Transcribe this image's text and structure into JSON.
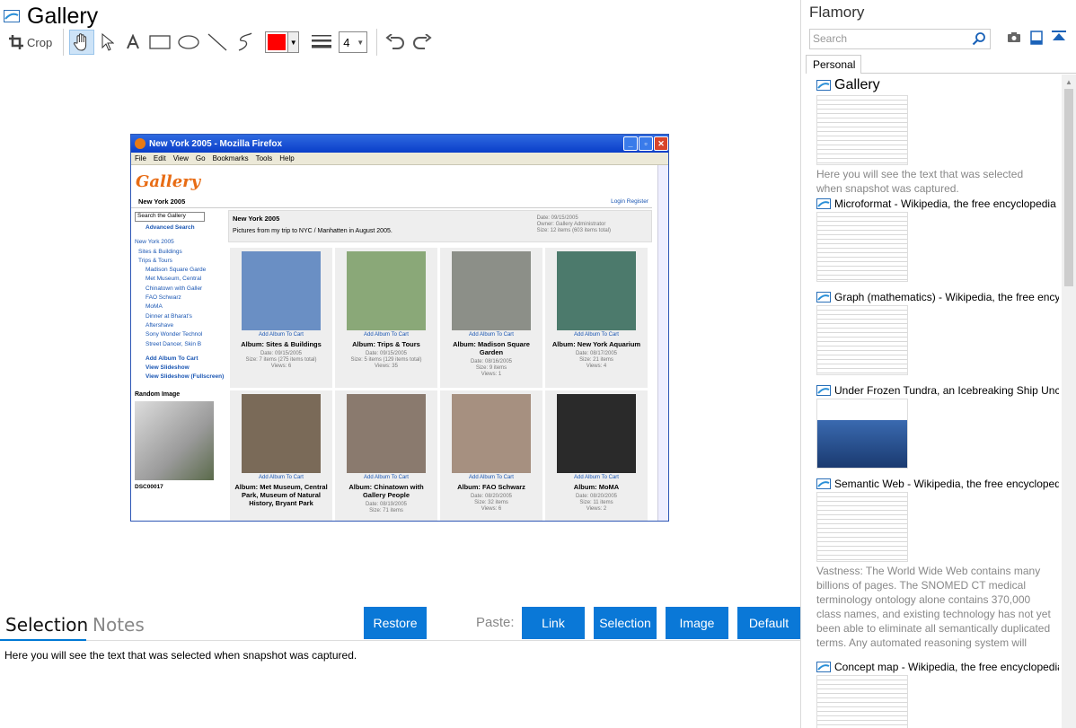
{
  "app": {
    "title": "Gallery",
    "colors": {
      "accent": "#0a78d7",
      "current_color": "#ff0000"
    }
  },
  "toolbar": {
    "crop_label": "Crop",
    "line_width": "4",
    "tools": [
      "crop-icon",
      "hand-icon",
      "pointer-icon",
      "text-icon",
      "rectangle-icon",
      "ellipse-icon",
      "line-icon",
      "freehand-icon",
      "color-picker",
      "line-width-icon",
      "undo-icon",
      "redo-icon"
    ]
  },
  "snapshot": {
    "window_title": "New York 2005 - Mozilla Firefox",
    "menu": [
      "File",
      "Edit",
      "View",
      "Go",
      "Bookmarks",
      "Tools",
      "Help"
    ],
    "logo": "Gallery",
    "breadcrumb": "New York 2005",
    "login": "Login   Register",
    "search_placeholder": "Search the Gallery",
    "advanced_search": "Advanced Search",
    "side_links": [
      "New York 2005",
      "Sites & Buildings",
      "Trips & Tours",
      "Madison Square Garde",
      "Met Museum, Central",
      "Chinatown with Galler",
      "FAO Schwarz",
      "MoMA",
      "Dinner at Bharat's",
      "Aftershave",
      "Sony Wonder Technol",
      "Street Dancer, Skin B"
    ],
    "side_actions": [
      "Add Album To Cart",
      "View Slideshow",
      "View Slideshow (Fullscreen)"
    ],
    "random_image_label": "Random Image",
    "random_image_caption": "DSC00017",
    "album_title": "New York 2005",
    "album_desc": "Pictures from my trip to NYC / Manhatten in August 2005.",
    "album_meta": [
      "Date: 09/15/2005",
      "Owner: Gallery Administrator",
      "Size: 12 items (603 items total)"
    ],
    "add_to_cart": "Add Album To Cart",
    "albums": [
      {
        "cap": "Album: Sites & Buildings",
        "m1": "Date: 09/15/2005",
        "m2": "Size: 7 items (275 items total)",
        "m3": "Views: 6",
        "color": "#6a8fc4"
      },
      {
        "cap": "Album: Trips & Tours",
        "m1": "Date: 09/15/2005",
        "m2": "Size: 5 items (129 items total)",
        "m3": "Views: 35",
        "color": "#8aa878"
      },
      {
        "cap": "Album: Madison Square Garden",
        "m1": "Date: 08/16/2005",
        "m2": "Size: 9 items",
        "m3": "Views: 1",
        "color": "#8c8f88"
      },
      {
        "cap": "Album: New York Aquarium",
        "m1": "Date: 08/17/2005",
        "m2": "Size: 21 items",
        "m3": "Views: 4",
        "color": "#4c7a6c"
      },
      {
        "cap": "Album: Met Museum, Central Park, Museum of Natural History, Bryant Park",
        "m1": "",
        "m2": "",
        "m3": "",
        "color": "#7a6a58"
      },
      {
        "cap": "Album: Chinatown with Gallery People",
        "m1": "Date: 08/19/2005",
        "m2": "Size: 71 items",
        "m3": "",
        "color": "#8a7a6e"
      },
      {
        "cap": "Album: FAO Schwarz",
        "m1": "Date: 08/20/2005",
        "m2": "Size: 32 items",
        "m3": "Views: 6",
        "color": "#a69080"
      },
      {
        "cap": "Album: MoMA",
        "m1": "Date: 08/20/2005",
        "m2": "Size: 11 items",
        "m3": "Views: 2",
        "color": "#2a2a2a"
      }
    ]
  },
  "bottom": {
    "tab_selection": "Selection",
    "tab_notes": "Notes",
    "restore": "Restore",
    "paste_label": "Paste:",
    "paste_buttons": [
      "Link",
      "Selection",
      "Image",
      "Default"
    ],
    "selection_text": "Here you will see the text that was selected when snapshot was captured."
  },
  "sidebar": {
    "title": "Flamory",
    "search_placeholder": "Search",
    "tab": "Personal",
    "items": [
      {
        "label": "Gallery",
        "desc": "Here you will see the text that was selected when snapshot was captured."
      },
      {
        "label": "Microformat - Wikipedia, the free encyclopedia",
        "desc": ""
      },
      {
        "label": "Graph (mathematics) - Wikipedia, the free encyclopedia",
        "desc": ""
      },
      {
        "label": "Under Frozen Tundra, an Icebreaking Ship Uncovers",
        "desc": ""
      },
      {
        "label": "Semantic Web - Wikipedia, the free encyclopedia",
        "desc": "Vastness: The World Wide Web contains many billions of pages. The SNOMED CT medical terminology ontology alone contains 370,000 class names, and existing technology has not yet been able to eliminate all semantically duplicated terms. Any automated reasoning system will have to deal with truly huge inputs."
      },
      {
        "label": "Concept map - Wikipedia, the free encyclopedia",
        "desc": ""
      }
    ]
  }
}
